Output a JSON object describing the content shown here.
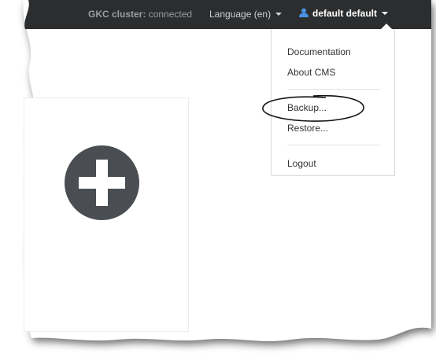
{
  "topbar": {
    "cluster_label": "GKC cluster:",
    "cluster_status": "connected",
    "language": "Language (en)",
    "user": "default default"
  },
  "user_menu": {
    "items": [
      "Documentation",
      "About CMS",
      "Backup...",
      "Restore...",
      "Logout"
    ]
  },
  "main": {
    "add_icon": "plus-circle-icon"
  },
  "colors": {
    "topbar_bg": "#2b2d2f",
    "user_icon": "#4a90e2",
    "add_button": "#4a4e52"
  }
}
